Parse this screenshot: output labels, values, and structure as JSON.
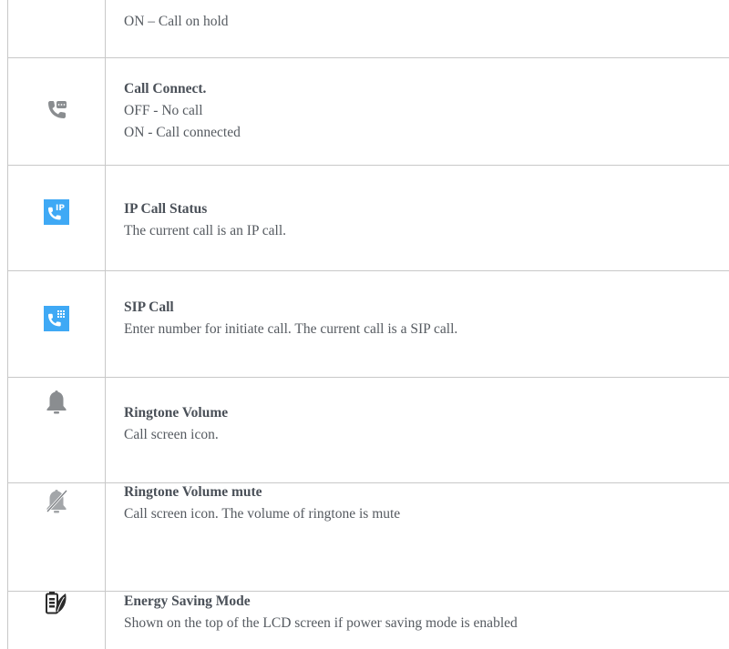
{
  "rows": [
    {
      "icon": "",
      "title": "",
      "lines": [
        "ON – Call on hold"
      ]
    },
    {
      "icon": "call-connect-icon",
      "title": "Call Connect.",
      "lines": [
        "OFF - No call",
        "ON - Call connected"
      ]
    },
    {
      "icon": "ip-call-icon",
      "title": "IP Call Status",
      "lines": [
        "The current call is an IP call."
      ]
    },
    {
      "icon": "sip-call-icon",
      "title": "SIP Call",
      "lines": [
        "Enter number for initiate call. The current call is a SIP call."
      ]
    },
    {
      "icon": "bell-icon",
      "title": "Ringtone Volume",
      "lines": [
        "Call screen icon."
      ]
    },
    {
      "icon": "bell-mute-icon",
      "title": "Ringtone Volume mute",
      "lines": [
        "Call screen icon. The volume of ringtone is mute"
      ]
    },
    {
      "icon": "energy-saving-icon",
      "title": "Energy Saving Mode",
      "lines": [
        "Shown on the top of the LCD screen if power saving mode is enabled"
      ]
    }
  ],
  "colors": {
    "ip_icon_bg": "#3fa9f5",
    "grey_icon": "#8a8d90",
    "border": "#c8c8c8"
  }
}
